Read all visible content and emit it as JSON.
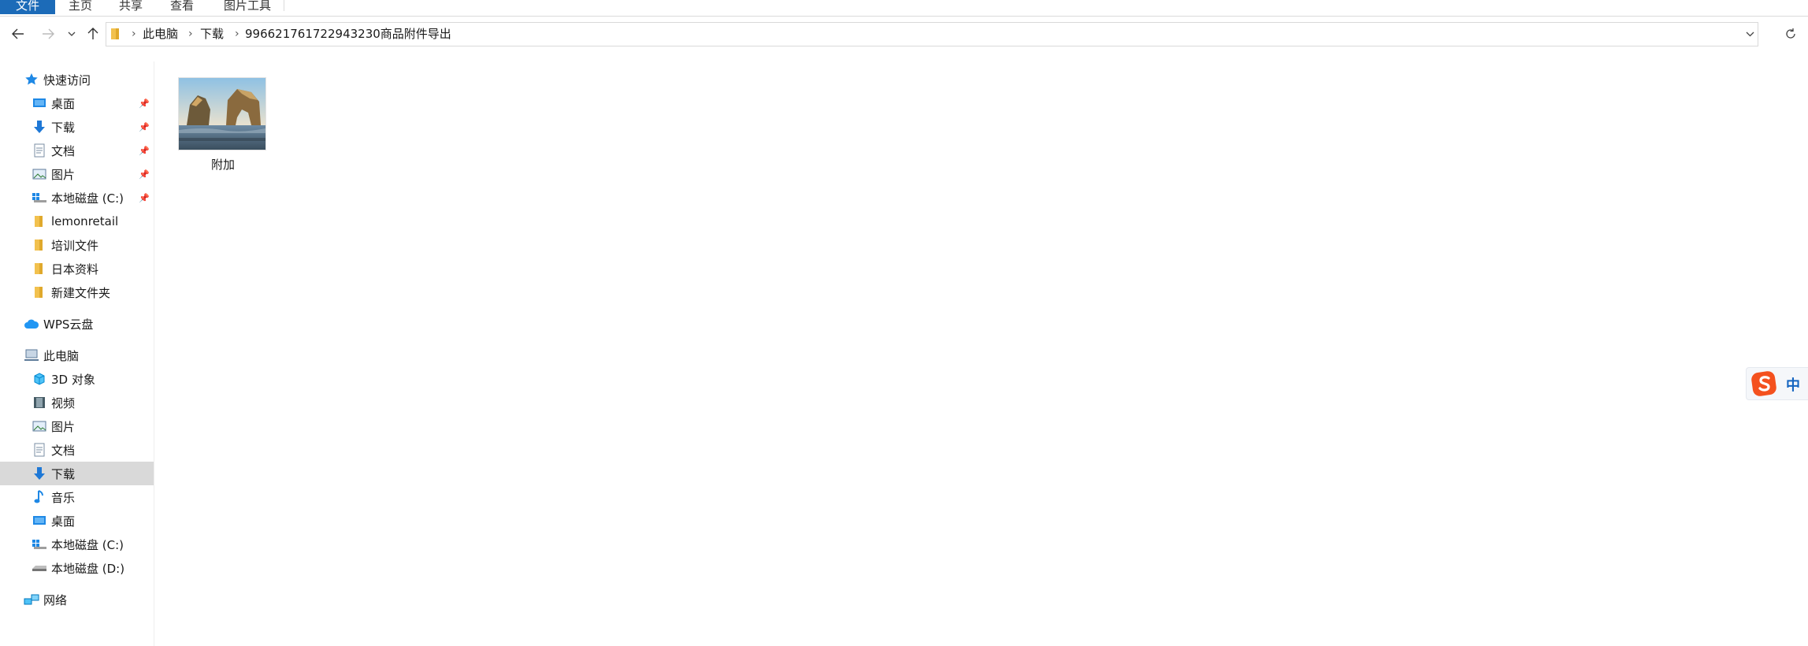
{
  "ribbon": {
    "tabs": [
      "文件",
      "主页",
      "共享",
      "查看",
      "图片工具"
    ]
  },
  "address": {
    "crumbs": [
      "此电脑",
      "下载",
      "996621761722943230商品附件导出"
    ]
  },
  "nav": {
    "quick_access": "快速访问",
    "quick_items": [
      "桌面",
      "下载",
      "文档",
      "图片",
      "本地磁盘 (C:)",
      "lemonretail",
      "培训文件",
      "日本资料",
      "新建文件夹"
    ],
    "wps": "WPS云盘",
    "this_pc": "此电脑",
    "pc_items": [
      "3D 对象",
      "视频",
      "图片",
      "文档",
      "下载",
      "音乐",
      "桌面",
      "本地磁盘 (C:)",
      "本地磁盘 (D:)"
    ],
    "network": "网络"
  },
  "files": [
    {
      "name": "附加",
      "type": "image"
    }
  ],
  "ime": {
    "mode": "中"
  },
  "colors": {
    "file_tab": "#1c6bb8",
    "selected": "#d9d9d9",
    "folder": "#f2c14e"
  }
}
